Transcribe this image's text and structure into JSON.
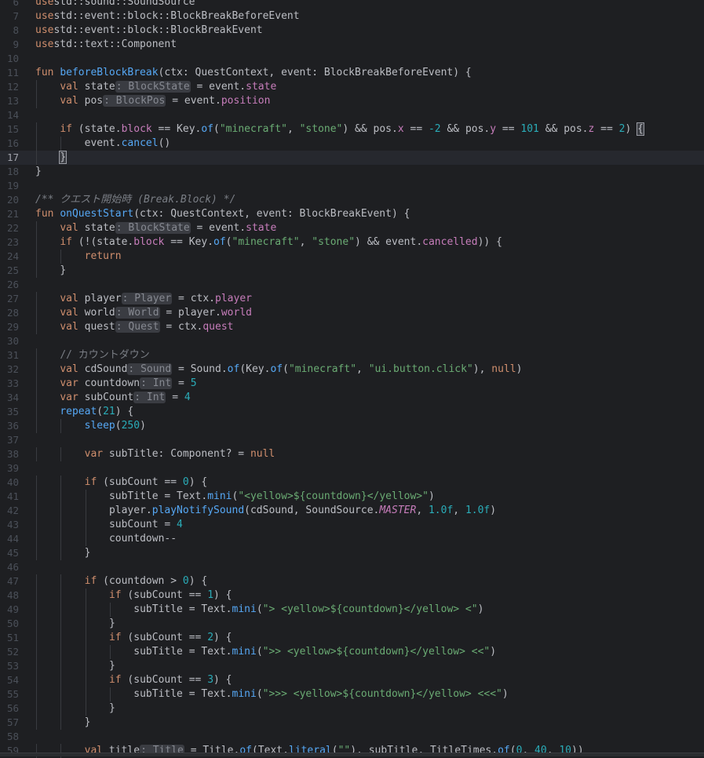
{
  "editor": {
    "current_line": 17,
    "lines": [
      {
        "n": "6",
        "t": [
          [
            "kw",
            "use"
          ],
          [
            "",
            "std::sound::SoundSource"
          ]
        ]
      },
      {
        "n": "7",
        "t": [
          [
            "kw",
            "use"
          ],
          [
            "",
            "std::event::block::BlockBreakBeforeEvent"
          ]
        ]
      },
      {
        "n": "8",
        "t": [
          [
            "kw",
            "use"
          ],
          [
            "",
            "std::event::block::BlockBreakEvent"
          ]
        ]
      },
      {
        "n": "9",
        "t": [
          [
            "kw",
            "use"
          ],
          [
            "",
            "std::text::Component"
          ]
        ]
      },
      {
        "n": "10",
        "t": []
      },
      {
        "n": "11",
        "t": [
          [
            "kw",
            "fun"
          ],
          [
            "fn",
            "beforeBlockBreak"
          ],
          [
            "",
            "(ctx: QuestContext, event: BlockBreakBeforeEvent) {"
          ]
        ]
      },
      {
        "n": "12",
        "i": 1,
        "t": [
          [
            "kw",
            "val"
          ],
          [
            "",
            " state"
          ],
          [
            "hint",
            ": BlockState"
          ],
          [
            "",
            " = event."
          ],
          [
            "prop",
            "state"
          ]
        ]
      },
      {
        "n": "13",
        "i": 1,
        "t": [
          [
            "kw",
            "val"
          ],
          [
            "",
            " pos"
          ],
          [
            "hint",
            ": BlockPos"
          ],
          [
            "",
            " = event."
          ],
          [
            "prop",
            "position"
          ]
        ]
      },
      {
        "n": "14",
        "t": []
      },
      {
        "n": "15",
        "i": 1,
        "t": [
          [
            "kw",
            "if"
          ],
          [
            "",
            " (state."
          ],
          [
            "prop",
            "block"
          ],
          [
            "",
            " == Key."
          ],
          [
            "fn",
            "of"
          ],
          [
            "",
            "("
          ],
          [
            "str",
            "\"minecraft\""
          ],
          [
            "",
            ", "
          ],
          [
            "str",
            "\"stone\""
          ],
          [
            "",
            ") && pos."
          ],
          [
            "prop",
            "x"
          ],
          [
            "",
            " == "
          ],
          [
            "num",
            "-2"
          ],
          [
            "",
            " && pos."
          ],
          [
            "prop",
            "y"
          ],
          [
            "",
            " == "
          ],
          [
            "num",
            "101"
          ],
          [
            "",
            " && pos."
          ],
          [
            "prop",
            "z"
          ],
          [
            "",
            " == "
          ],
          [
            "num",
            "2"
          ],
          [
            "",
            ") "
          ],
          [
            "bh",
            "{"
          ]
        ]
      },
      {
        "n": "16",
        "i": 2,
        "t": [
          [
            "",
            "event."
          ],
          [
            "fn",
            "cancel"
          ],
          [
            "",
            "()"
          ]
        ]
      },
      {
        "n": "17",
        "i": 1,
        "t": [
          [
            "bh",
            "}"
          ]
        ]
      },
      {
        "n": "18",
        "t": [
          [
            "",
            "}"
          ]
        ]
      },
      {
        "n": "19",
        "t": []
      },
      {
        "n": "20",
        "t": [
          [
            "cmt",
            "/** クエスト開始時 (Break.Block) */"
          ]
        ]
      },
      {
        "n": "21",
        "t": [
          [
            "kw",
            "fun"
          ],
          [
            "fn",
            "onQuestStart"
          ],
          [
            "",
            "(ctx: QuestContext, event: BlockBreakEvent) {"
          ]
        ]
      },
      {
        "n": "22",
        "i": 1,
        "t": [
          [
            "kw",
            "val"
          ],
          [
            "",
            " state"
          ],
          [
            "hint",
            ": BlockState"
          ],
          [
            "",
            " = event."
          ],
          [
            "prop",
            "state"
          ]
        ]
      },
      {
        "n": "23",
        "i": 1,
        "t": [
          [
            "kw",
            "if"
          ],
          [
            "",
            " (!(state."
          ],
          [
            "prop",
            "block"
          ],
          [
            "",
            " == Key."
          ],
          [
            "fn",
            "of"
          ],
          [
            "",
            "("
          ],
          [
            "str",
            "\"minecraft\""
          ],
          [
            "",
            ", "
          ],
          [
            "str",
            "\"stone\""
          ],
          [
            "",
            ") && event."
          ],
          [
            "prop",
            "cancelled"
          ],
          [
            "",
            ")) {"
          ]
        ]
      },
      {
        "n": "24",
        "i": 2,
        "t": [
          [
            "kw",
            "return"
          ]
        ]
      },
      {
        "n": "25",
        "i": 1,
        "t": [
          [
            "",
            "}"
          ]
        ]
      },
      {
        "n": "26",
        "t": []
      },
      {
        "n": "27",
        "i": 1,
        "t": [
          [
            "kw",
            "val"
          ],
          [
            "",
            " player"
          ],
          [
            "hint",
            ": Player"
          ],
          [
            "",
            " = ctx."
          ],
          [
            "prop",
            "player"
          ]
        ]
      },
      {
        "n": "28",
        "i": 1,
        "t": [
          [
            "kw",
            "val"
          ],
          [
            "",
            " world"
          ],
          [
            "hint",
            ": World"
          ],
          [
            "",
            " = player."
          ],
          [
            "prop",
            "world"
          ]
        ]
      },
      {
        "n": "29",
        "i": 1,
        "t": [
          [
            "kw",
            "val"
          ],
          [
            "",
            " quest"
          ],
          [
            "hint",
            ": Quest"
          ],
          [
            "",
            " = ctx."
          ],
          [
            "prop",
            "quest"
          ]
        ]
      },
      {
        "n": "30",
        "t": []
      },
      {
        "n": "31",
        "i": 1,
        "t": [
          [
            "lc",
            "// カウントダウン"
          ]
        ]
      },
      {
        "n": "32",
        "i": 1,
        "t": [
          [
            "kw",
            "val"
          ],
          [
            "",
            " cdSound"
          ],
          [
            "hint",
            ": Sound"
          ],
          [
            "",
            " = Sound."
          ],
          [
            "fn",
            "of"
          ],
          [
            "",
            "(Key."
          ],
          [
            "fn",
            "of"
          ],
          [
            "",
            "("
          ],
          [
            "str",
            "\"minecraft\""
          ],
          [
            "",
            ", "
          ],
          [
            "str",
            "\"ui.button.click\""
          ],
          [
            "",
            "), "
          ],
          [
            "kw",
            "null"
          ],
          [
            "",
            ")"
          ]
        ]
      },
      {
        "n": "33",
        "i": 1,
        "t": [
          [
            "kw",
            "var"
          ],
          [
            "",
            " countdown"
          ],
          [
            "hint",
            ": Int"
          ],
          [
            "",
            " = "
          ],
          [
            "num",
            "5"
          ]
        ]
      },
      {
        "n": "34",
        "i": 1,
        "t": [
          [
            "kw",
            "var"
          ],
          [
            "",
            " subCount"
          ],
          [
            "hint",
            ": Int"
          ],
          [
            "",
            " = "
          ],
          [
            "num",
            "4"
          ]
        ]
      },
      {
        "n": "35",
        "i": 1,
        "t": [
          [
            "fn",
            "repeat"
          ],
          [
            "",
            "("
          ],
          [
            "num",
            "21"
          ],
          [
            "",
            ") {"
          ]
        ]
      },
      {
        "n": "36",
        "i": 2,
        "t": [
          [
            "fn",
            "sleep"
          ],
          [
            "",
            "("
          ],
          [
            "num",
            "250"
          ],
          [
            "",
            ")"
          ]
        ]
      },
      {
        "n": "37",
        "t": []
      },
      {
        "n": "38",
        "i": 2,
        "t": [
          [
            "kw",
            "var"
          ],
          [
            "",
            " subTitle: Component? = "
          ],
          [
            "kw",
            "null"
          ]
        ]
      },
      {
        "n": "39",
        "t": []
      },
      {
        "n": "40",
        "i": 2,
        "t": [
          [
            "kw",
            "if"
          ],
          [
            "",
            " (subCount == "
          ],
          [
            "num",
            "0"
          ],
          [
            "",
            ") {"
          ]
        ]
      },
      {
        "n": "41",
        "i": 3,
        "t": [
          [
            "",
            "subTitle = Text."
          ],
          [
            "fn",
            "mini"
          ],
          [
            "",
            "("
          ],
          [
            "str",
            "\"<yellow>${countdown}</yellow>\""
          ],
          [
            "",
            ")"
          ]
        ]
      },
      {
        "n": "42",
        "i": 3,
        "t": [
          [
            "",
            "player."
          ],
          [
            "fn",
            "playNotifySound"
          ],
          [
            "",
            "(cdSound, SoundSource."
          ],
          [
            "cst",
            "MASTER"
          ],
          [
            "",
            ", "
          ],
          [
            "num",
            "1.0f"
          ],
          [
            "",
            ", "
          ],
          [
            "num",
            "1.0f"
          ],
          [
            "",
            ")"
          ]
        ]
      },
      {
        "n": "43",
        "i": 3,
        "t": [
          [
            "",
            "subCount = "
          ],
          [
            "num",
            "4"
          ]
        ]
      },
      {
        "n": "44",
        "i": 3,
        "t": [
          [
            "",
            "countdown--"
          ]
        ]
      },
      {
        "n": "45",
        "i": 2,
        "t": [
          [
            "",
            "}"
          ]
        ]
      },
      {
        "n": "46",
        "t": []
      },
      {
        "n": "47",
        "i": 2,
        "t": [
          [
            "kw",
            "if"
          ],
          [
            "",
            " (countdown > "
          ],
          [
            "num",
            "0"
          ],
          [
            "",
            ") {"
          ]
        ]
      },
      {
        "n": "48",
        "i": 3,
        "t": [
          [
            "kw",
            "if"
          ],
          [
            "",
            " (subCount == "
          ],
          [
            "num",
            "1"
          ],
          [
            "",
            ") {"
          ]
        ]
      },
      {
        "n": "49",
        "i": 4,
        "t": [
          [
            "",
            "subTitle = Text."
          ],
          [
            "fn",
            "mini"
          ],
          [
            "",
            "("
          ],
          [
            "str",
            "\"> <yellow>${countdown}</yellow> <\""
          ],
          [
            "",
            ")"
          ]
        ]
      },
      {
        "n": "50",
        "i": 3,
        "t": [
          [
            "",
            "}"
          ]
        ]
      },
      {
        "n": "51",
        "i": 3,
        "t": [
          [
            "kw",
            "if"
          ],
          [
            "",
            " (subCount == "
          ],
          [
            "num",
            "2"
          ],
          [
            "",
            ") {"
          ]
        ]
      },
      {
        "n": "52",
        "i": 4,
        "t": [
          [
            "",
            "subTitle = Text."
          ],
          [
            "fn",
            "mini"
          ],
          [
            "",
            "("
          ],
          [
            "str",
            "\">> <yellow>${countdown}</yellow> <<\""
          ],
          [
            "",
            ")"
          ]
        ]
      },
      {
        "n": "53",
        "i": 3,
        "t": [
          [
            "",
            "}"
          ]
        ]
      },
      {
        "n": "54",
        "i": 3,
        "t": [
          [
            "kw",
            "if"
          ],
          [
            "",
            " (subCount == "
          ],
          [
            "num",
            "3"
          ],
          [
            "",
            ") {"
          ]
        ]
      },
      {
        "n": "55",
        "i": 4,
        "t": [
          [
            "",
            "subTitle = Text."
          ],
          [
            "fn",
            "mini"
          ],
          [
            "",
            "("
          ],
          [
            "str",
            "\">>> <yellow>${countdown}</yellow> <<<\""
          ],
          [
            "",
            ")"
          ]
        ]
      },
      {
        "n": "56",
        "i": 3,
        "t": [
          [
            "",
            "}"
          ]
        ]
      },
      {
        "n": "57",
        "i": 2,
        "t": [
          [
            "",
            "}"
          ]
        ]
      },
      {
        "n": "58",
        "t": []
      },
      {
        "n": "59",
        "i": 2,
        "t": [
          [
            "kw",
            "val"
          ],
          [
            "",
            " title"
          ],
          [
            "hint",
            ": Title"
          ],
          [
            "",
            " = Title."
          ],
          [
            "fn",
            "of"
          ],
          [
            "",
            "(Text."
          ],
          [
            "fn",
            "literal"
          ],
          [
            "",
            "("
          ],
          [
            "str",
            "\"\""
          ],
          [
            "",
            "), subTitle, TitleTimes."
          ],
          [
            "fn",
            "of"
          ],
          [
            "",
            "("
          ],
          [
            "num",
            "0"
          ],
          [
            "",
            ", "
          ],
          [
            "num",
            "40"
          ],
          [
            "",
            ", "
          ],
          [
            "num",
            "10"
          ],
          [
            "",
            "))"
          ]
        ]
      }
    ]
  }
}
